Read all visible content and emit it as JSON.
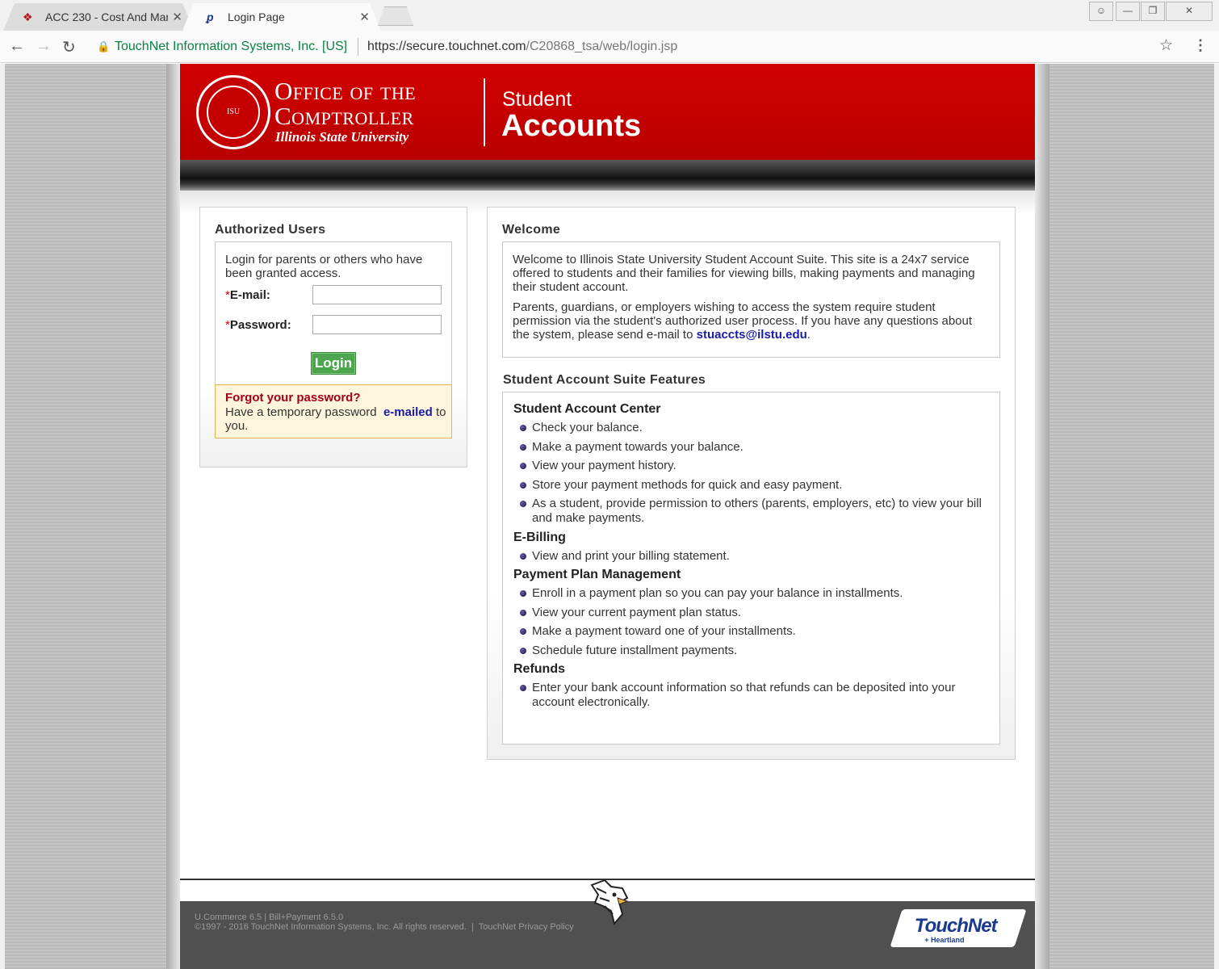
{
  "browser": {
    "tabs": [
      {
        "label": "ACC 230 - Cost And Man",
        "active": false
      },
      {
        "label": "Login Page",
        "active": true
      }
    ],
    "cert_name": "TouchNet Information Systems, Inc. [US]",
    "url_host": "https://secure.touchnet.com",
    "url_path": "/C20868_tsa/web/login.jsp"
  },
  "header": {
    "office_line1": "Office of the",
    "office_line2": "Comptroller",
    "university": "Illinois State University",
    "section_top": "Student",
    "section_bottom": "Accounts",
    "seal_text": "ISU"
  },
  "login": {
    "title": "Authorized Users",
    "intro": "Login for parents or others who have been granted access.",
    "email_label": "E-mail:",
    "password_label": "Password:",
    "required_mark": "*",
    "email_value": "",
    "password_value": "",
    "login_button": "Login",
    "forgot_title": "Forgot your password?",
    "forgot_text_before": "Have a temporary password",
    "forgot_link": "e-mailed",
    "forgot_text_after": "to you."
  },
  "welcome": {
    "title": "Welcome",
    "para1": "Welcome to Illinois State University Student Account Suite. This site is a 24x7 service offered to students and their families for viewing bills, making payments and managing their student account.",
    "para2_before": "Parents, guardians, or employers wishing to access the system require student permission via the student's authorized user process. If you have any questions about the system, please send e-mail to",
    "email_link": "stuaccts@ilstu.edu",
    "para2_after": "."
  },
  "features": {
    "title": "Student Account Suite Features",
    "sections": [
      {
        "heading": "Student Account Center",
        "items": [
          "Check your balance.",
          "Make a payment towards your balance.",
          "View your payment history.",
          "Store your payment methods for quick and easy payment.",
          "As a student, provide permission to others (parents, employers, etc) to view your bill and make payments."
        ]
      },
      {
        "heading": "E-Billing",
        "items": [
          "View and print your billing statement."
        ]
      },
      {
        "heading": "Payment Plan Management",
        "items": [
          "Enroll in a payment plan so you can pay your balance in installments.",
          "View your current payment plan status.",
          "Make a payment toward one of your installments.",
          "Schedule future installment payments."
        ]
      },
      {
        "heading": "Refunds",
        "items": [
          "Enter your bank account information so that refunds can be deposited into your account electronically."
        ]
      }
    ]
  },
  "footer": {
    "version": "U.Commerce 6.5 | Bill+Payment 6.5.0",
    "copyright": "©1997 - 2016  TouchNet Information Systems, Inc. All rights reserved.",
    "privacy_link": "TouchNet Privacy Policy",
    "brand": "TouchNet",
    "brand_sub": "+ Heartland"
  }
}
